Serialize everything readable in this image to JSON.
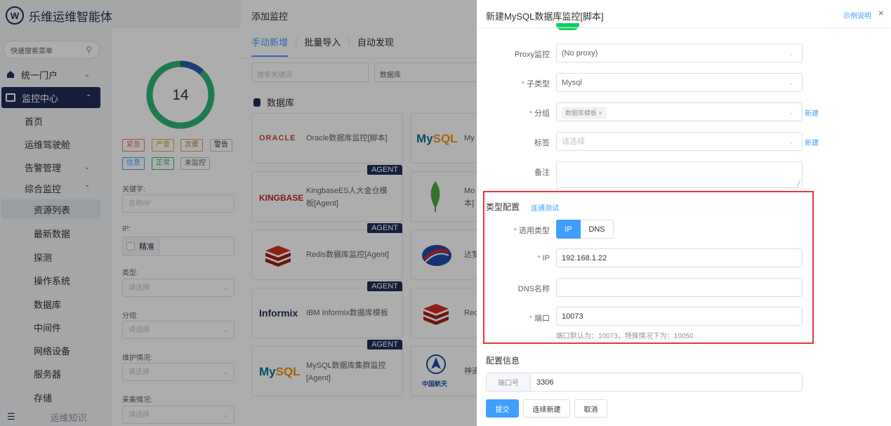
{
  "app": {
    "title": "乐维运维智能体",
    "logo_letter": "W"
  },
  "sidebar": {
    "search_placeholder": "快速搜索菜单",
    "items": [
      {
        "label": "统一门户"
      },
      {
        "label": "监控中心"
      },
      {
        "label": "首页"
      },
      {
        "label": "运维驾驶舱"
      },
      {
        "label": "告警管理"
      },
      {
        "label": "综合监控"
      },
      {
        "label": "资源列表"
      },
      {
        "label": "最新数据"
      },
      {
        "label": "探测"
      },
      {
        "label": "操作系统"
      },
      {
        "label": "数据库"
      },
      {
        "label": "中间件"
      },
      {
        "label": "网络设备"
      },
      {
        "label": "服务器"
      },
      {
        "label": "存储"
      }
    ],
    "footer_text": "运维知识"
  },
  "filter_panel": {
    "total": "14",
    "severity": [
      "紧急",
      "严重",
      "次要",
      "警告",
      "信息",
      "正常",
      "未监控"
    ],
    "keyword_label": "关键字:",
    "keyword_placeholder": "名称/IP",
    "ip_label": "IP:",
    "precise_label": "精准",
    "type_label": "类型:",
    "type_placeholder": "请选择",
    "group_label": "分组:",
    "group_placeholder": "请选择",
    "maint_label": "维护情况:",
    "maint_placeholder": "请选择",
    "collect_label": "采集情况:",
    "collect_placeholder": "请选择"
  },
  "add_panel": {
    "title": "添加监控",
    "tabs": [
      "手动新增",
      "批量导入",
      "自动发现"
    ],
    "search_placeholder": "搜索关键词",
    "category": "数据库",
    "section": "数据库",
    "agent_badge": "AGENT",
    "cards": [
      {
        "logo": "ORACLE",
        "name": "Oracle数据库监控[脚本]"
      },
      {
        "logo": "KINGBASE",
        "name": "KingbaseES人大金仓模板[Agent]"
      },
      {
        "logo": "redis",
        "name": "Redis数据库监控[Agent]"
      },
      {
        "logo": "Informix",
        "name": "IBM Informix数据库模板"
      },
      {
        "logo": "MySQL",
        "name": "MySQL数据库集群监控[Agent]"
      }
    ],
    "cards_right": [
      {
        "name": "My"
      },
      {
        "name": "Mo本]"
      },
      {
        "name": "达梦"
      },
      {
        "name": "Red"
      },
      {
        "name": "神通",
        "logo": "中国航天"
      }
    ]
  },
  "drawer": {
    "title": "新建MySQL数据库监控[脚本]",
    "example_link": "示例说明",
    "close": "×",
    "proxy_label": "Proxy监控",
    "proxy_value": "(No proxy)",
    "subtype_label": "子类型",
    "subtype_value": "Mysql",
    "group_label": "分组",
    "group_tag": "数据库模板",
    "new_link": "新建",
    "tag_label": "标签",
    "tag_placeholder": "请选择",
    "remark_label": "备注",
    "type_config_title": "类型配置",
    "conn_test": "连通测试",
    "select_type_label": "选用类型",
    "type_options": [
      "IP",
      "DNS"
    ],
    "ip_label": "IP",
    "ip_value": "192.168.1.22",
    "dns_label": "DNS名称",
    "port_label": "端口",
    "port_value": "10073",
    "port_hint": "端口默认为：10073，特殊情况下为：10050",
    "config_title": "配置信息",
    "cfg_port_label": "端口号",
    "cfg_port_value": "3306",
    "buttons": {
      "submit": "提交",
      "continue": "连续新建",
      "cancel": "取消"
    }
  }
}
